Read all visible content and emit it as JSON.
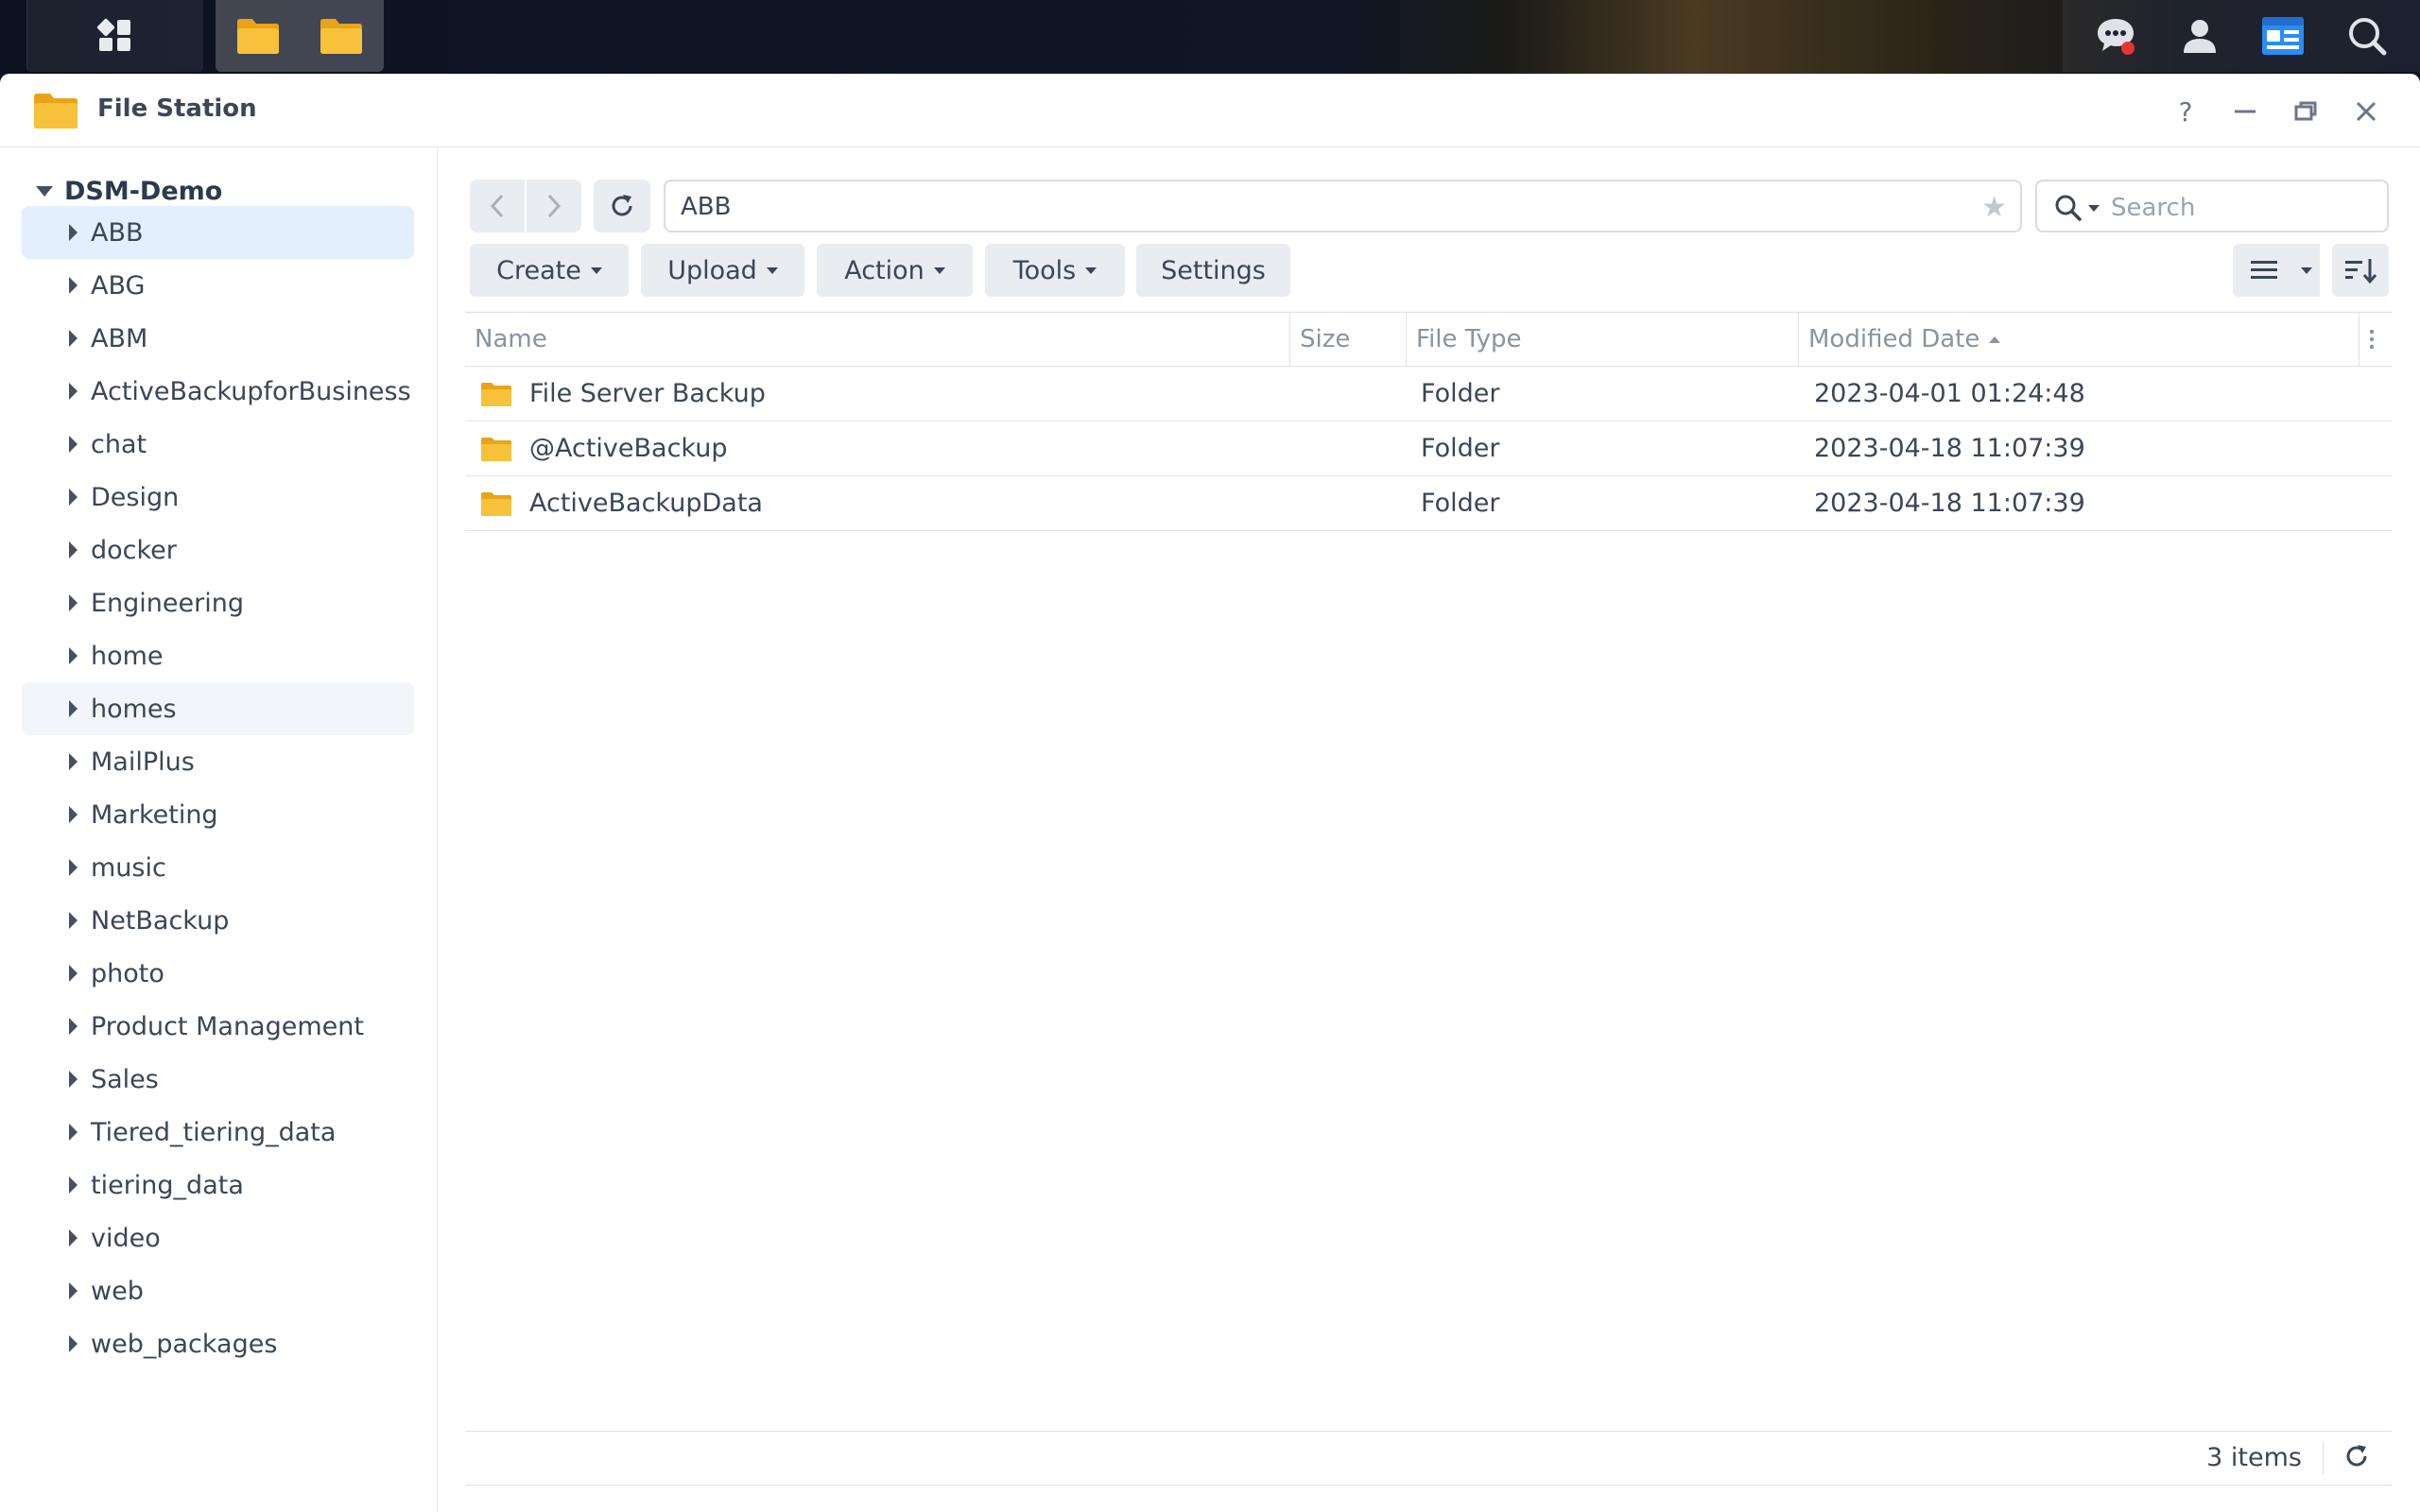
{
  "window": {
    "title": "File Station"
  },
  "sidebar": {
    "root": "DSM-Demo",
    "items": [
      {
        "label": "ABB"
      },
      {
        "label": "ABG"
      },
      {
        "label": "ABM"
      },
      {
        "label": "ActiveBackupforBusiness"
      },
      {
        "label": "chat"
      },
      {
        "label": "Design"
      },
      {
        "label": "docker"
      },
      {
        "label": "Engineering"
      },
      {
        "label": "home"
      },
      {
        "label": "homes"
      },
      {
        "label": "MailPlus"
      },
      {
        "label": "Marketing"
      },
      {
        "label": "music"
      },
      {
        "label": "NetBackup"
      },
      {
        "label": "photo"
      },
      {
        "label": "Product Management"
      },
      {
        "label": "Sales"
      },
      {
        "label": "Tiered_tiering_data"
      },
      {
        "label": "tiering_data"
      },
      {
        "label": "video"
      },
      {
        "label": "web"
      },
      {
        "label": "web_packages"
      }
    ],
    "selected": "ABB"
  },
  "toolbar": {
    "path": "ABB",
    "search_placeholder": "Search",
    "create_label": "Create",
    "upload_label": "Upload",
    "action_label": "Action",
    "tools_label": "Tools",
    "settings_label": "Settings"
  },
  "table": {
    "columns": [
      "Name",
      "Size",
      "File Type",
      "Modified Date"
    ],
    "sort_column": "Modified Date",
    "sort_direction": "ascending",
    "rows": [
      {
        "name": "File Server Backup",
        "size": "",
        "type": "Folder",
        "modified": "2023-04-01 01:24:48"
      },
      {
        "name": "@ActiveBackup",
        "size": "",
        "type": "Folder",
        "modified": "2023-04-18 11:07:39"
      },
      {
        "name": "ActiveBackupData",
        "size": "",
        "type": "Folder",
        "modified": "2023-04-18 11:07:39"
      }
    ]
  },
  "status": {
    "item_count": "3 items"
  },
  "colors": {
    "accent": "#1e7cf2",
    "folder": "#f7b928",
    "selected_row": "#e3effd",
    "notification": "#e8333a"
  },
  "icons": {
    "taskbar": [
      "main-menu-icon",
      "file-station-icon",
      "file-station-icon",
      "chat-icon",
      "user-icon",
      "widgets-icon",
      "search-icon"
    ]
  }
}
